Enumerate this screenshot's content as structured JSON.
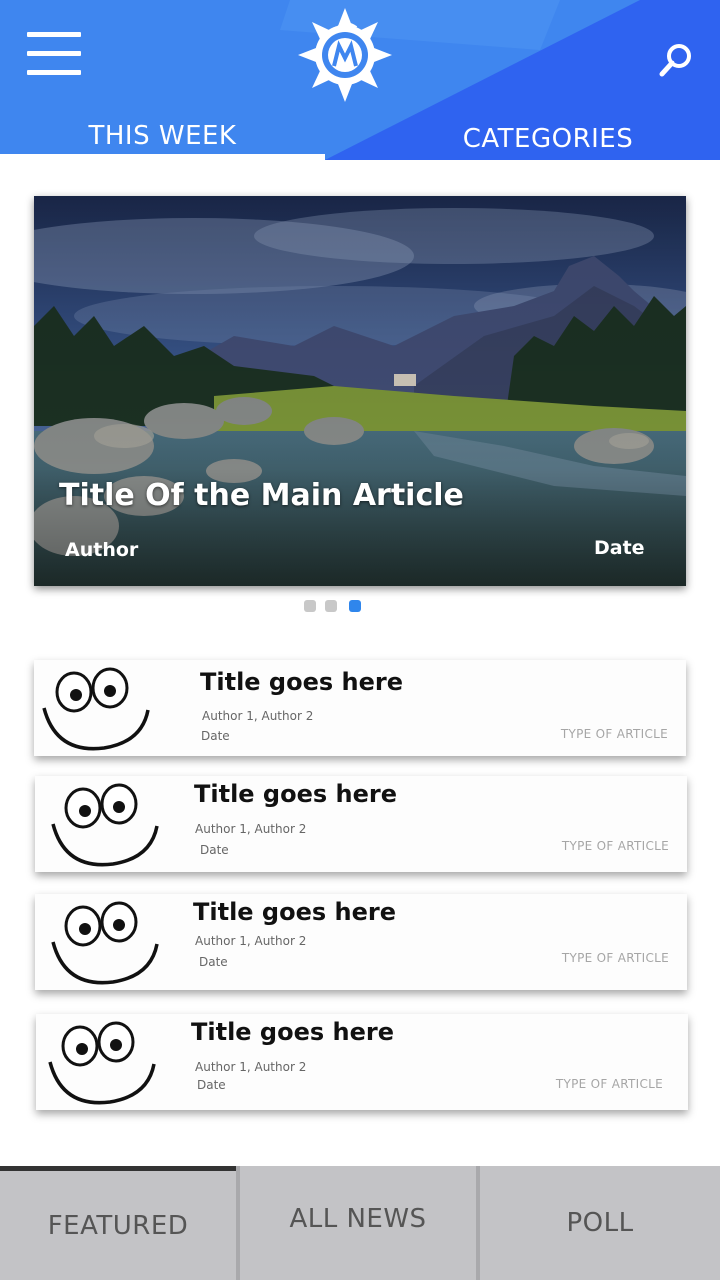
{
  "header": {
    "tabs": [
      {
        "label": "THIS WEEK",
        "active": true
      },
      {
        "label": "CATEGORIES",
        "active": false
      }
    ],
    "menu_icon": "hamburger-menu-icon",
    "search_icon": "search-icon",
    "logo_icon": "sun-logo-icon",
    "colors": {
      "primary": "#3f86ef",
      "secondary": "#2f63f0"
    }
  },
  "hero": {
    "title": "Title Of the Main Article",
    "author": "Author",
    "date": "Date",
    "slides": 3,
    "active_slide": 3
  },
  "articles": [
    {
      "title": "Title goes here",
      "authors": "Author 1, Author 2",
      "date": "Date",
      "type": "TYPE OF ARTICLE"
    },
    {
      "title": "Title goes here",
      "authors": "Author 1, Author 2",
      "date": "Date",
      "type": "TYPE OF ARTICLE"
    },
    {
      "title": "Title goes here",
      "authors": "Author 1, Author 2",
      "date": "Date",
      "type": "TYPE OF ARTICLE"
    },
    {
      "title": "Title goes here",
      "authors": "Author 1, Author 2",
      "date": "Date",
      "type": "TYPE OF ARTICLE"
    }
  ],
  "bottom_nav": {
    "tabs": [
      {
        "label": "FEATURED",
        "active": true
      },
      {
        "label": "ALL NEWS",
        "active": false
      },
      {
        "label": "POLL",
        "active": false
      }
    ]
  }
}
